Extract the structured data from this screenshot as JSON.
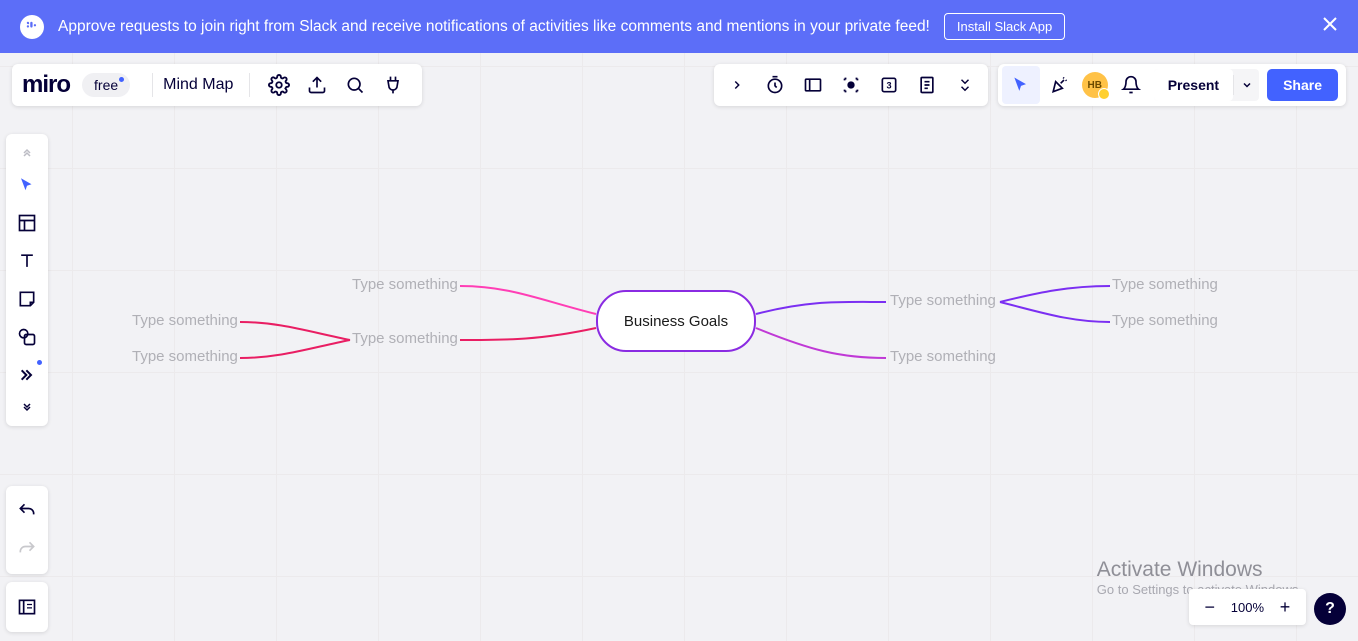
{
  "banner": {
    "text": "Approve requests to join right from Slack and receive notifications of activities like comments and mentions in your private feed!",
    "button": "Install Slack App"
  },
  "header": {
    "logo": "miro",
    "badge": "free",
    "board_name": "Mind Map",
    "avatar_initials": "HB",
    "present": "Present",
    "share": "Share"
  },
  "mindmap": {
    "center": "Business Goals",
    "nodes": {
      "l1a": "Type something",
      "l1b": "Type something",
      "l2a": "Type something",
      "l2b": "Type something",
      "r1": "Type something",
      "r2": "Type something",
      "r1a": "Type something",
      "r1b": "Type something"
    }
  },
  "zoom": {
    "level": "100%"
  },
  "watermark": {
    "line1": "Activate Windows",
    "line2": "Go to Settings to activate Windows."
  }
}
